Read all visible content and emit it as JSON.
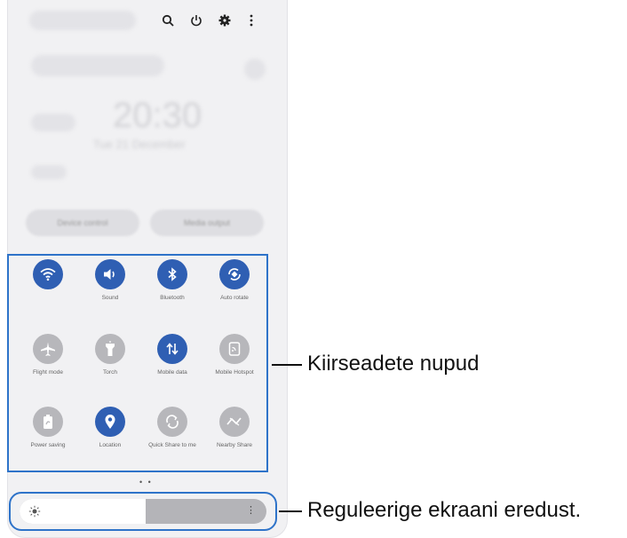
{
  "header": {
    "icons": [
      "search-icon",
      "power-icon",
      "gear-icon",
      "more-vertical-icon"
    ]
  },
  "lockscreen": {
    "time": "20:30",
    "date": "Tue 21 December",
    "buttons": [
      "Device control",
      "Media output"
    ]
  },
  "quick_settings": {
    "tiles": [
      {
        "label": "",
        "icon": "wifi-icon",
        "on": true
      },
      {
        "label": "Sound",
        "icon": "sound-icon",
        "on": true
      },
      {
        "label": "Bluetooth",
        "icon": "bluetooth-icon",
        "on": true
      },
      {
        "label": "Auto rotate",
        "icon": "auto-rotate-icon",
        "on": true
      },
      {
        "label": "Flight mode",
        "icon": "airplane-icon",
        "on": false
      },
      {
        "label": "Torch",
        "icon": "torch-icon",
        "on": false
      },
      {
        "label": "Mobile data",
        "icon": "mobile-data-icon",
        "on": true
      },
      {
        "label": "Mobile Hotspot",
        "icon": "hotspot-icon",
        "on": false
      },
      {
        "label": "Power saving",
        "icon": "battery-icon",
        "on": false
      },
      {
        "label": "Location",
        "icon": "location-icon",
        "on": true
      },
      {
        "label": "Quick Share to me",
        "icon": "quick-share-icon",
        "on": false
      },
      {
        "label": "Nearby Share",
        "icon": "nearby-share-icon",
        "on": false
      }
    ],
    "page_indicator": "• •"
  },
  "brightness": {
    "level_percent": 51,
    "icon": "sun-icon",
    "more_icon": "⋮"
  },
  "callouts": {
    "quick_buttons": "Kiirseadete nupud",
    "brightness": "Reguleerige ekraani eredust."
  },
  "colors": {
    "accent": "#2f5fb3",
    "highlight_box": "#2e73c9",
    "tile_off": "#b7b7bb"
  }
}
